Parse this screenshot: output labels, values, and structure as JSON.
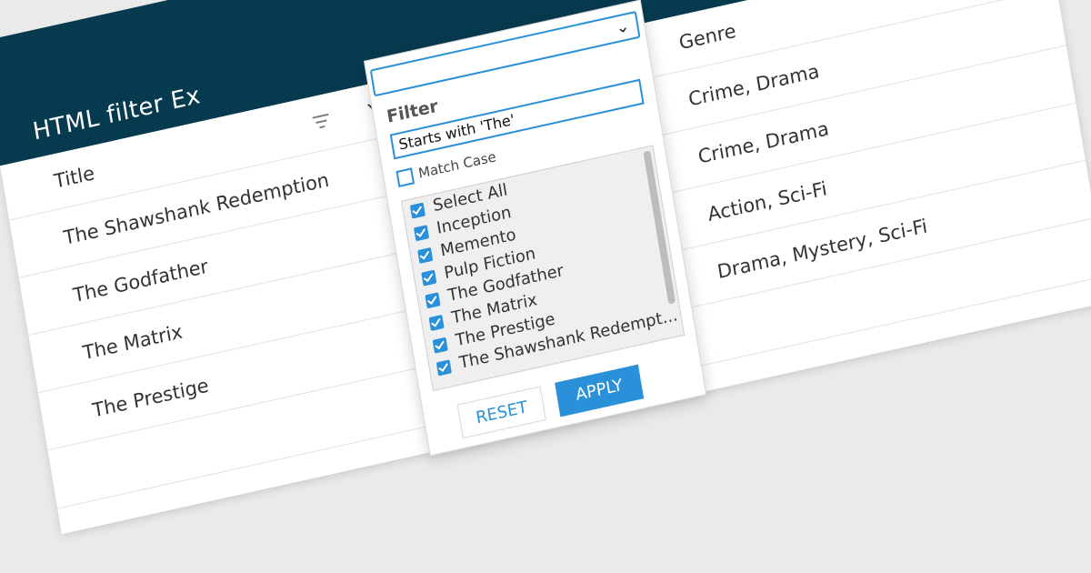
{
  "app": {
    "title": "HTML filter Ex"
  },
  "columns": [
    {
      "label": "Title"
    },
    {
      "label": "Year"
    },
    {
      "label": "Genre"
    }
  ],
  "rows": [
    {
      "title": "The Shawshank Redemption",
      "genre": "Crime, Drama"
    },
    {
      "title": "The Godfather",
      "genre": "Crime, Drama"
    },
    {
      "title": "The Matrix",
      "genre": "Action, Sci-Fi"
    },
    {
      "title": "The Prestige",
      "genre": "Drama, Mystery, Sci-Fi"
    }
  ],
  "filter_popup": {
    "heading": "Filter",
    "input_value": "Starts with 'The'",
    "match_case_label": "Match Case",
    "items": [
      "Select All",
      "Inception",
      "Memento",
      "Pulp Fiction",
      "The Godfather",
      "The Matrix",
      "The Prestige",
      "The Shawshank Redempt..."
    ],
    "reset_label": "RESET",
    "apply_label": "APPLY"
  },
  "colors": {
    "header_bg": "#063b4f",
    "accent": "#2a90d9"
  }
}
